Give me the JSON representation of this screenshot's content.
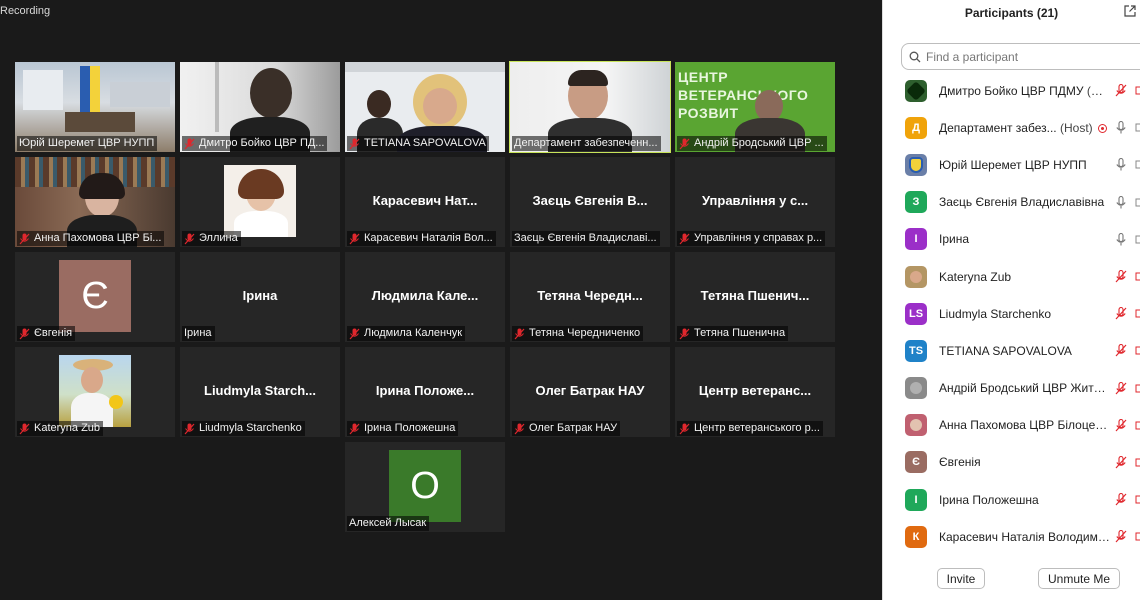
{
  "recording_label": "Recording",
  "gallery": {
    "tiles": [
      {
        "label": "Юрій Шеремет ЦВР НУПП",
        "big": "",
        "muted": false
      },
      {
        "label": "Дмитро Бойко ЦВР ПД...",
        "big": "",
        "muted": true
      },
      {
        "label": "TETIANA SAPOVALOVA",
        "big": "",
        "muted": true
      },
      {
        "label": "Департамент забезпеченн...",
        "big": "",
        "muted": false
      },
      {
        "label": "Андрій Бродський ЦВР ...",
        "big": "",
        "muted": true
      },
      {
        "label": "Анна Пахомова ЦВР Бі...",
        "big": "",
        "muted": true
      },
      {
        "label": "Эллина",
        "big": "",
        "muted": true
      },
      {
        "label": "Карасевич Наталія Вол...",
        "big": "Карасевич Нат...",
        "muted": true
      },
      {
        "label": "Заєць Євгенія Владиславі...",
        "big": "Заєць Євгенія В...",
        "muted": false
      },
      {
        "label": "Управління у справах р...",
        "big": "Управління у с...",
        "muted": true
      },
      {
        "label": "Євгенія",
        "big": "",
        "muted": true
      },
      {
        "label": "Ірина",
        "big": "Ірина",
        "muted": false
      },
      {
        "label": "Людмила Каленчук",
        "big": "Людмила Кале...",
        "muted": true
      },
      {
        "label": "Тетяна Чередниченко",
        "big": "Тетяна Чередн...",
        "muted": true
      },
      {
        "label": "Тетяна Пшенична",
        "big": "Тетяна Пшенич...",
        "muted": true
      },
      {
        "label": "Kateryna Zub",
        "big": "",
        "muted": true
      },
      {
        "label": "Liudmyla Starchenko",
        "big": "Liudmyla Starch...",
        "muted": true
      },
      {
        "label": "Ірина Положешна",
        "big": "Ірина Положе...",
        "muted": true
      },
      {
        "label": "Олег Батрак НАУ",
        "big": "Олег Батрак НАУ",
        "muted": true
      },
      {
        "label": "Центр ветеранського р...",
        "big": "Центр ветеранс...",
        "muted": true
      },
      {
        "label": "Алексей Лысак",
        "big": "",
        "muted": false
      }
    ],
    "avatar_letters": {
      "yevheniia": "Є",
      "oleksii": "O"
    },
    "banner_text": [
      "ЦЕНТР",
      "ВЕТЕРАНСЬКОГО",
      "РОЗВИТ"
    ],
    "colors": {
      "active_border": "#c8e45a",
      "muted_icon": "#e0272d"
    }
  },
  "panel": {
    "title": "Participants (21)",
    "search_placeholder": "Find a participant",
    "participants": [
      {
        "name": "Дмитро Бойко ЦВР ПДМУ",
        "note": "(Me)",
        "avatar": "",
        "color": "#2e5f2e",
        "mic": "muted-red"
      },
      {
        "name": "Департамент забез...",
        "note": "(Host)",
        "avatar": "Д",
        "color": "#f0a30a",
        "mic": "on",
        "rec": true
      },
      {
        "name": "Юрій Шеремет ЦВР НУПП",
        "note": "",
        "avatar": "",
        "color": "#6a7fa8",
        "mic": "on"
      },
      {
        "name": "Заєць Євгенія Владиславівна",
        "note": "",
        "avatar": "З",
        "color": "#1fa85a",
        "mic": "on"
      },
      {
        "name": "Ірина",
        "note": "",
        "avatar": "І",
        "color": "#9b2fc8",
        "mic": "on"
      },
      {
        "name": "Kateryna Zub",
        "note": "",
        "avatar": "",
        "color": "#b49664",
        "mic": "muted-red"
      },
      {
        "name": "Liudmyla Starchenko",
        "note": "",
        "avatar": "LS",
        "color": "#9b2fc8",
        "mic": "muted-red"
      },
      {
        "name": "TETIANA SAPOVALOVA",
        "note": "",
        "avatar": "TS",
        "color": "#1f82c8",
        "mic": "muted-red"
      },
      {
        "name": "Андрій Бродський ЦВР Житом...",
        "note": "",
        "avatar": "",
        "color": "#8a8a8a",
        "mic": "muted-red"
      },
      {
        "name": "Анна Пахомова ЦВР Білоцеркі...",
        "note": "",
        "avatar": "",
        "color": "#c06070",
        "mic": "muted-red"
      },
      {
        "name": "Євгенія",
        "note": "",
        "avatar": "Є",
        "color": "#9a6c62",
        "mic": "muted-red"
      },
      {
        "name": "Ірина Положешна",
        "note": "",
        "avatar": "І",
        "color": "#1fa85a",
        "mic": "muted-red"
      },
      {
        "name": "Карасевич Наталія Володими...",
        "note": "",
        "avatar": "К",
        "color": "#e06a10",
        "mic": "muted-red"
      }
    ],
    "invite_label": "Invite",
    "unmute_label": "Unmute Me"
  }
}
